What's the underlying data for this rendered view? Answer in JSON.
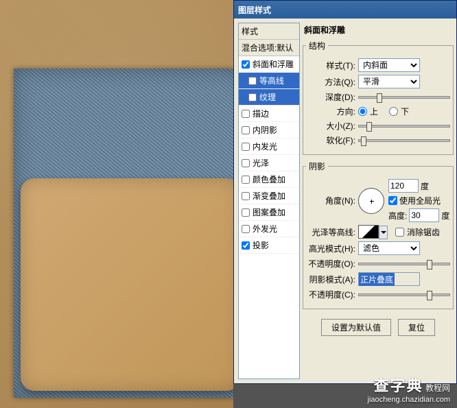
{
  "dialog": {
    "title": "图层样式",
    "styleListHeader": "样式",
    "blendOptions": "混合选项:默认",
    "items": [
      {
        "label": "斜面和浮雕",
        "checked": true,
        "selected": false,
        "indent": false
      },
      {
        "label": "等高线",
        "checked": false,
        "selected": true,
        "indent": true
      },
      {
        "label": "纹理",
        "checked": false,
        "selected": true,
        "indent": true
      },
      {
        "label": "描边",
        "checked": false,
        "selected": false,
        "indent": false
      },
      {
        "label": "内阴影",
        "checked": false,
        "selected": false,
        "indent": false
      },
      {
        "label": "内发光",
        "checked": false,
        "selected": false,
        "indent": false
      },
      {
        "label": "光泽",
        "checked": false,
        "selected": false,
        "indent": false
      },
      {
        "label": "颜色叠加",
        "checked": false,
        "selected": false,
        "indent": false
      },
      {
        "label": "渐变叠加",
        "checked": false,
        "selected": false,
        "indent": false
      },
      {
        "label": "图案叠加",
        "checked": false,
        "selected": false,
        "indent": false
      },
      {
        "label": "外发光",
        "checked": false,
        "selected": false,
        "indent": false
      },
      {
        "label": "投影",
        "checked": true,
        "selected": false,
        "indent": false
      }
    ]
  },
  "bevel": {
    "panelTitle": "斜面和浮雕",
    "structureLegend": "结构",
    "styleLabel": "样式(T):",
    "styleValue": "内斜面",
    "techniqueLabel": "方法(Q):",
    "techniqueValue": "平滑",
    "depthLabel": "深度(D):",
    "directionLabel": "方向:",
    "upLabel": "上",
    "downLabel": "下",
    "sizeLabel": "大小(Z):",
    "softenLabel": "软化(F):"
  },
  "shading": {
    "legend": "阴影",
    "angleLabel": "角度(N):",
    "angleValue": "120",
    "degree": "度",
    "globalLightLabel": "使用全局光",
    "altitudeLabel": "高度:",
    "altitudeValue": "30",
    "glossContourLabel": "光泽等高线:",
    "antiAliasLabel": "消除锯齿",
    "highlightModeLabel": "高光模式(H):",
    "highlightModeValue": "滤色",
    "highlightOpacityLabel": "不透明度(O):",
    "shadowModeLabel": "阴影模式(A):",
    "shadowModeValue": "正片叠底",
    "shadowOpacityLabel": "不透明度(C):"
  },
  "buttons": {
    "makeDefault": "设置为默认值",
    "reset": "复位"
  },
  "watermark": {
    "title": "查字典",
    "suffix": "教程网",
    "url": "jiaocheng.chazidian.com"
  }
}
